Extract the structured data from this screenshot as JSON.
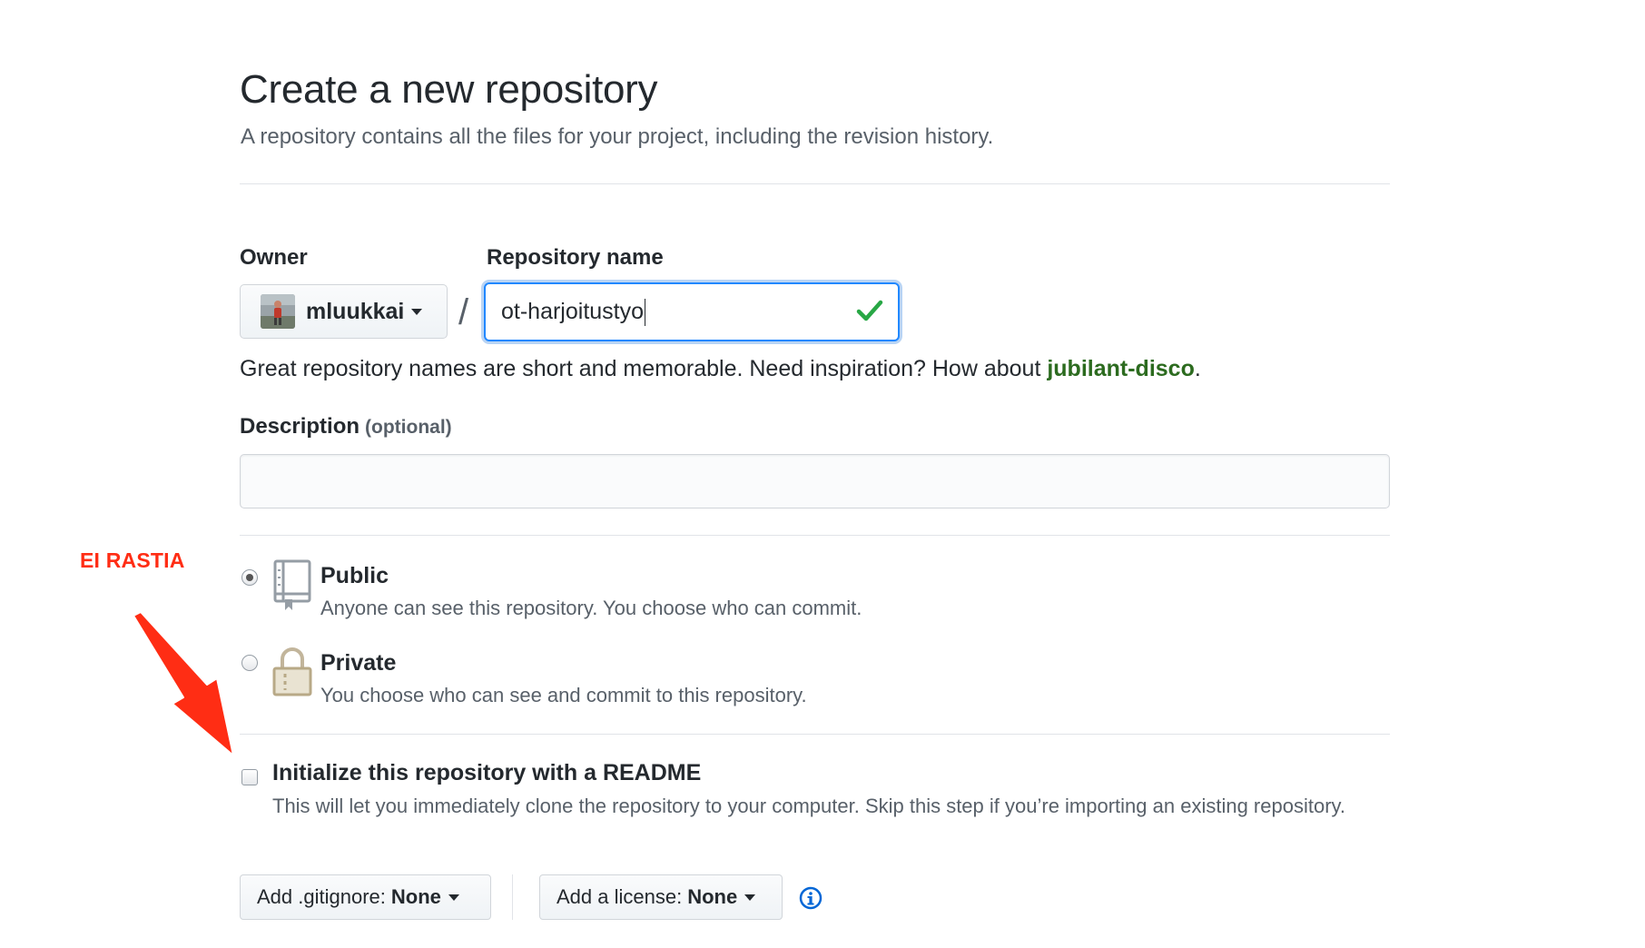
{
  "header": {
    "title": "Create a new repository",
    "subtitle": "A repository contains all the files for your project, including the revision history."
  },
  "owner": {
    "label": "Owner",
    "selected": "mluukkai"
  },
  "separator": "/",
  "repository": {
    "label": "Repository name",
    "value": "ot-harjoitustyo",
    "valid": true
  },
  "hint": {
    "text": "Great repository names are short and memorable. Need inspiration? How about ",
    "suggestion": "jubilant-disco",
    "end": "."
  },
  "description": {
    "label": "Description",
    "optional": "(optional)",
    "value": ""
  },
  "visibility": {
    "selected": "public",
    "public": {
      "title": "Public",
      "desc": "Anyone can see this repository. You choose who can commit.",
      "icon": "repo-icon"
    },
    "private": {
      "title": "Private",
      "desc": "You choose who can see and commit to this repository.",
      "icon": "lock-icon"
    }
  },
  "annotation": {
    "text": "EI RASTIA",
    "color": "#ff2d14"
  },
  "readme": {
    "checked": false,
    "title": "Initialize this repository with a README",
    "desc": "This will let you immediately clone the repository to your computer. Skip this step if you’re importing an existing repository."
  },
  "gitignore": {
    "label": "Add .gitignore:",
    "value": "None"
  },
  "license": {
    "label": "Add a license:",
    "value": "None"
  },
  "colors": {
    "accent": "#2188ff",
    "success": "#28a745",
    "suggestion": "#2c6b1f",
    "annotation": "#ff2d14"
  }
}
